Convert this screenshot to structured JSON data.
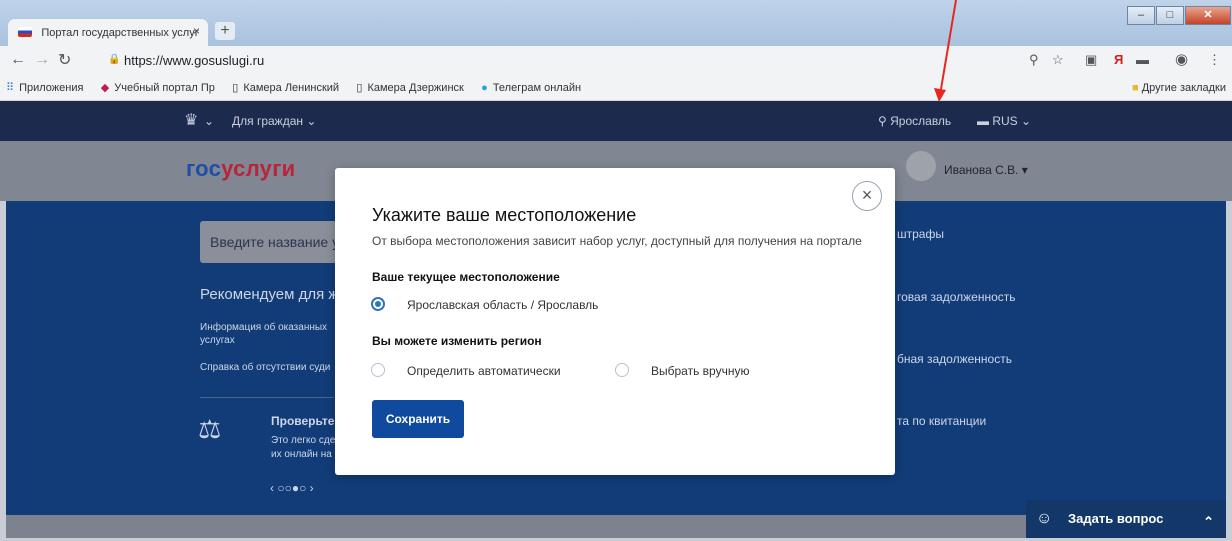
{
  "browser": {
    "tab_title": "Портал государственных услуг",
    "tab_close": "×",
    "new_tab": "+",
    "url": "https://www.gosuslugi.ru",
    "window_controls": {
      "minimize": "–",
      "maximize": "□",
      "close": "✕"
    },
    "bookmarks": [
      {
        "label": "Приложения",
        "icon": "apps-grid-icon"
      },
      {
        "label": "Учебный портал Пр",
        "icon": "graduation-cap-icon"
      },
      {
        "label": "Камера Ленинский",
        "icon": "page-icon"
      },
      {
        "label": "Камера Дзержинск",
        "icon": "page-icon"
      },
      {
        "label": "Телеграм онлайн",
        "icon": "telegram-icon"
      }
    ],
    "other_bookmarks": "Другие закладки"
  },
  "site": {
    "top_bar": {
      "for_citizens": "Для граждан ⌄",
      "location": "Ярославль",
      "language": "RUS ⌄"
    },
    "logo": {
      "part1": "гос",
      "part2": "услуги"
    },
    "user_name": "Иванова С.В. ▾",
    "search_placeholder": "Введите название усл",
    "recommend_title": "Рекомендуем для ж",
    "links": [
      "Информация об оказанных",
      "услугах",
      "Справка об отсутствии суди"
    ],
    "promo_title": "Проверьте",
    "promo_text": [
      "Это легко сде",
      "их онлайн на"
    ],
    "pager": "‹ ○○●○ ›",
    "right_items": [
      "штрафы",
      "говая задолженность",
      "бная задолженность",
      "та по квитанции"
    ],
    "chat_label": "Задать вопрос",
    "chat_chevron": "⌃"
  },
  "modal": {
    "title": "Укажите ваше местоположение",
    "subtitle": "От выбора местоположения зависит набор услуг, доступный для получения на портале",
    "current_heading": "Ваше текущее местоположение",
    "current_option": "Ярославская область / Ярославль",
    "change_heading": "Вы можете изменить регион",
    "auto_option": "Определить автоматически",
    "manual_option": "Выбрать вручную",
    "save_label": "Сохранить",
    "close": "×"
  }
}
